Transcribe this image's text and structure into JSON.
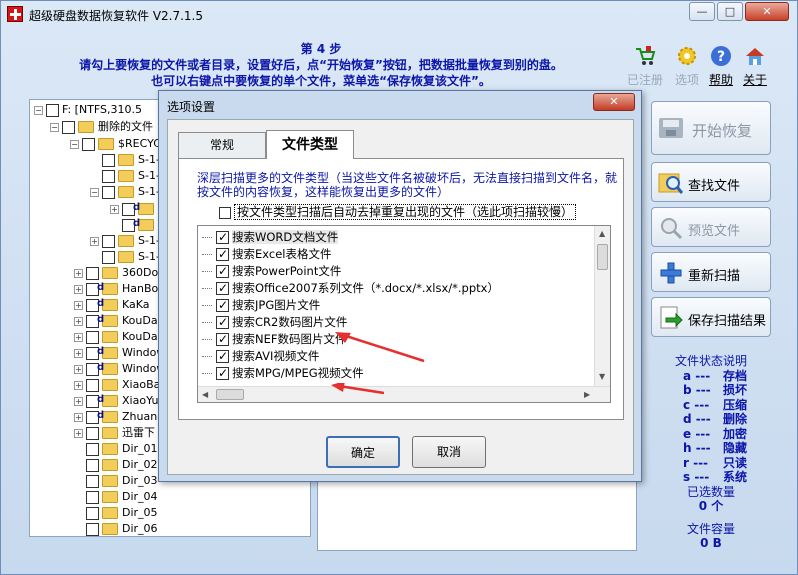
{
  "window": {
    "title": "超级硬盘数据恢复软件 V2.7.1.5",
    "controls": {
      "minimize": "—",
      "maximize": "□",
      "close": "✕"
    }
  },
  "header": {
    "step": "第 4 步",
    "line1": "请勾上要恢复的文件或者目录，设置好后，点“开始恢复”按钮，把数据批量恢复到别的盘。",
    "line2": "也可以右键点中要恢复的单个文件，菜单选“保存恢复该文件”。"
  },
  "toolbar": {
    "items": [
      {
        "label": "已注册",
        "icon": "cart-icon",
        "state": "disabled"
      },
      {
        "label": "选项",
        "icon": "gear-icon",
        "state": "disabled"
      },
      {
        "label": "帮助",
        "icon": "help-icon",
        "state": "link"
      },
      {
        "label": "关于",
        "icon": "home-icon",
        "state": "link"
      }
    ]
  },
  "tree": {
    "rows": [
      {
        "label": "F:  [NTFS,310.5"
      },
      {
        "label": "删除的文件"
      },
      {
        "label": "$RECYC"
      },
      {
        "label": "S-1-"
      },
      {
        "label": "S-1-"
      },
      {
        "label": "S-1-"
      },
      {
        "label": ""
      },
      {
        "label": ""
      },
      {
        "label": "S-1-"
      },
      {
        "label": "S-1-"
      },
      {
        "label": "360Dow"
      },
      {
        "label": "HanBoS"
      },
      {
        "label": "KaKa"
      },
      {
        "label": "KouDai"
      },
      {
        "label": "KouDai"
      },
      {
        "label": "Window"
      },
      {
        "label": "Window"
      },
      {
        "label": "XiaoBai"
      },
      {
        "label": "XiaoYu"
      },
      {
        "label": "Zhuang"
      },
      {
        "label": "迅雷下"
      },
      {
        "label": "Dir_01"
      },
      {
        "label": "Dir_02"
      },
      {
        "label": "Dir_03"
      },
      {
        "label": "Dir_04"
      },
      {
        "label": "Dir_05"
      },
      {
        "label": "Dir_06"
      }
    ]
  },
  "actions": {
    "start": "开始恢复",
    "find": "查找文件",
    "preview": "预览文件",
    "rescan": "重新扫描",
    "save_scan": "保存扫描结果"
  },
  "legend": {
    "title": "文件状态说明",
    "items": [
      {
        "key": "a ---",
        "value": "存档"
      },
      {
        "key": "b ---",
        "value": "损坏"
      },
      {
        "key": "c ---",
        "value": "压缩"
      },
      {
        "key": "d ---",
        "value": "删除"
      },
      {
        "key": "e ---",
        "value": "加密"
      },
      {
        "key": "h ---",
        "value": "隐藏"
      },
      {
        "key": "r ---",
        "value": "只读"
      },
      {
        "key": "s ---",
        "value": "系统"
      }
    ],
    "selected_count_label": "已选数量",
    "selected_count": "0 个",
    "capacity_label": "文件容量",
    "capacity": "0 B"
  },
  "dialog": {
    "title": "选项设置",
    "close": "✕",
    "tabs": {
      "general": "常规",
      "filetype": "文件类型"
    },
    "description": "深层扫描更多的文件类型（当这些文件名被破坏后，无法直接扫描到文件名，就按文件的内容恢复，这样能恢复出更多的文件）",
    "auto_remove_option": "按文件类型扫描后自动去掉重复出现的文件（选此项扫描较慢）",
    "filetypes": [
      {
        "label": "搜索WORD文档文件",
        "checked": true
      },
      {
        "label": "搜索Excel表格文件",
        "checked": true
      },
      {
        "label": "搜索PowerPoint文件",
        "checked": true
      },
      {
        "label": "搜索Office2007系列文件（*.docx/*.xlsx/*.pptx）",
        "checked": true
      },
      {
        "label": "搜索JPG图片文件",
        "checked": true
      },
      {
        "label": "搜索CR2数码图片文件",
        "checked": true
      },
      {
        "label": "搜索NEF数码图片文件",
        "checked": true
      },
      {
        "label": "搜索AVI视频文件",
        "checked": true
      },
      {
        "label": "搜索MPG/MPEG视频文件",
        "checked": true
      }
    ],
    "ok": "确定",
    "cancel": "取消"
  },
  "colors": {
    "accent_text": "#0c16a8",
    "annotation_arrow": "#e53030"
  }
}
